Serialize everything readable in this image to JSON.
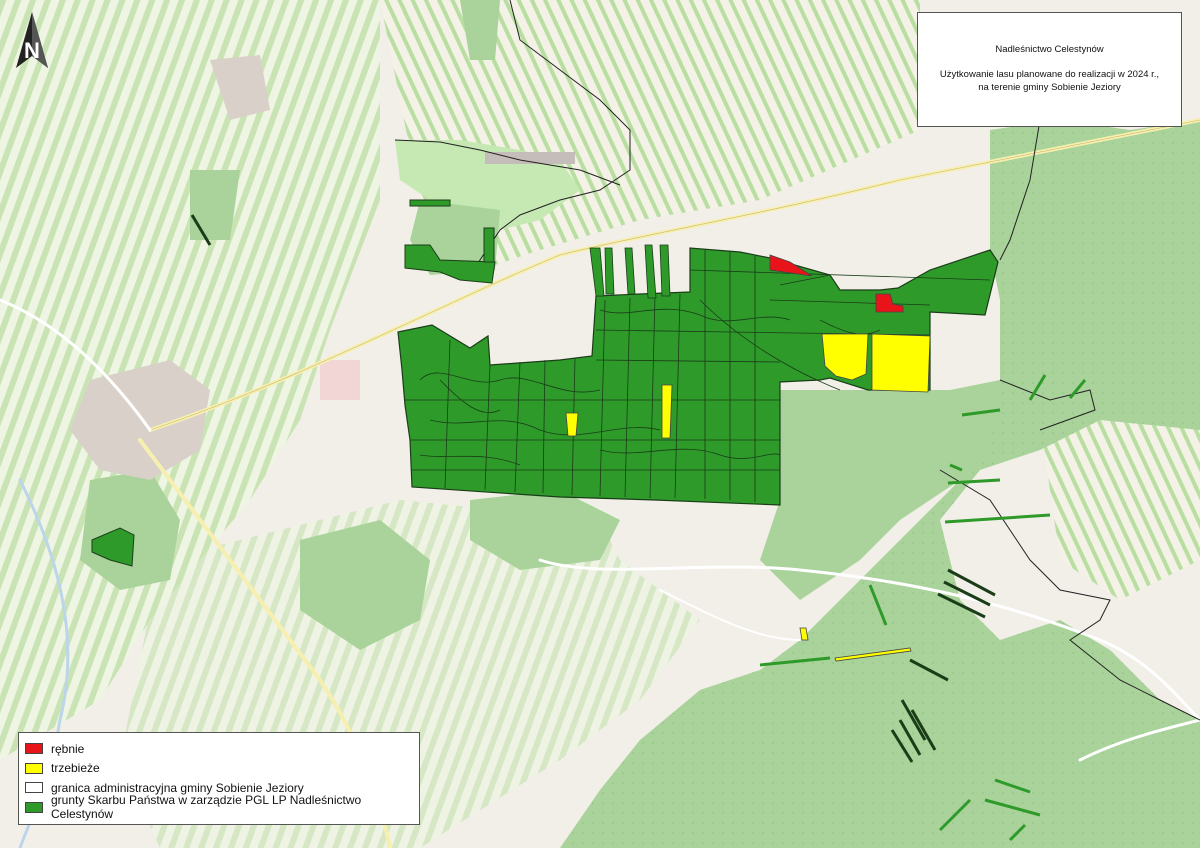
{
  "title": {
    "line1": "Nadleśnictwo Celestynów",
    "line2": "Użytkowanie lasu planowane do realizacji w 2024 r., na terenie gminy Sobienie Jeziory"
  },
  "legend": {
    "items": [
      {
        "label": "rębnie",
        "color": "#e8141a"
      },
      {
        "label": "trzebieże",
        "color": "#ffff00"
      },
      {
        "label": "granica administracyjna gminy Sobienie Jeziory",
        "color": "#ffffff"
      },
      {
        "label": "grunty Skarbu Państwa w zarządzie PGL LP Nadleśnictwo Celestynów",
        "color": "#2e9a2a"
      }
    ]
  },
  "north_arrow": {
    "icon": "north-arrow-icon",
    "letter": "N"
  },
  "map_colors": {
    "background": "#f2efe9",
    "forest": "#a9d39a",
    "farmland": "#e9f2d9",
    "state_forest": "#2e9a2a",
    "clear_cut": "#e8141a",
    "thinning": "#ffff00",
    "boundary": "#222222",
    "road": "#f7efb0"
  }
}
